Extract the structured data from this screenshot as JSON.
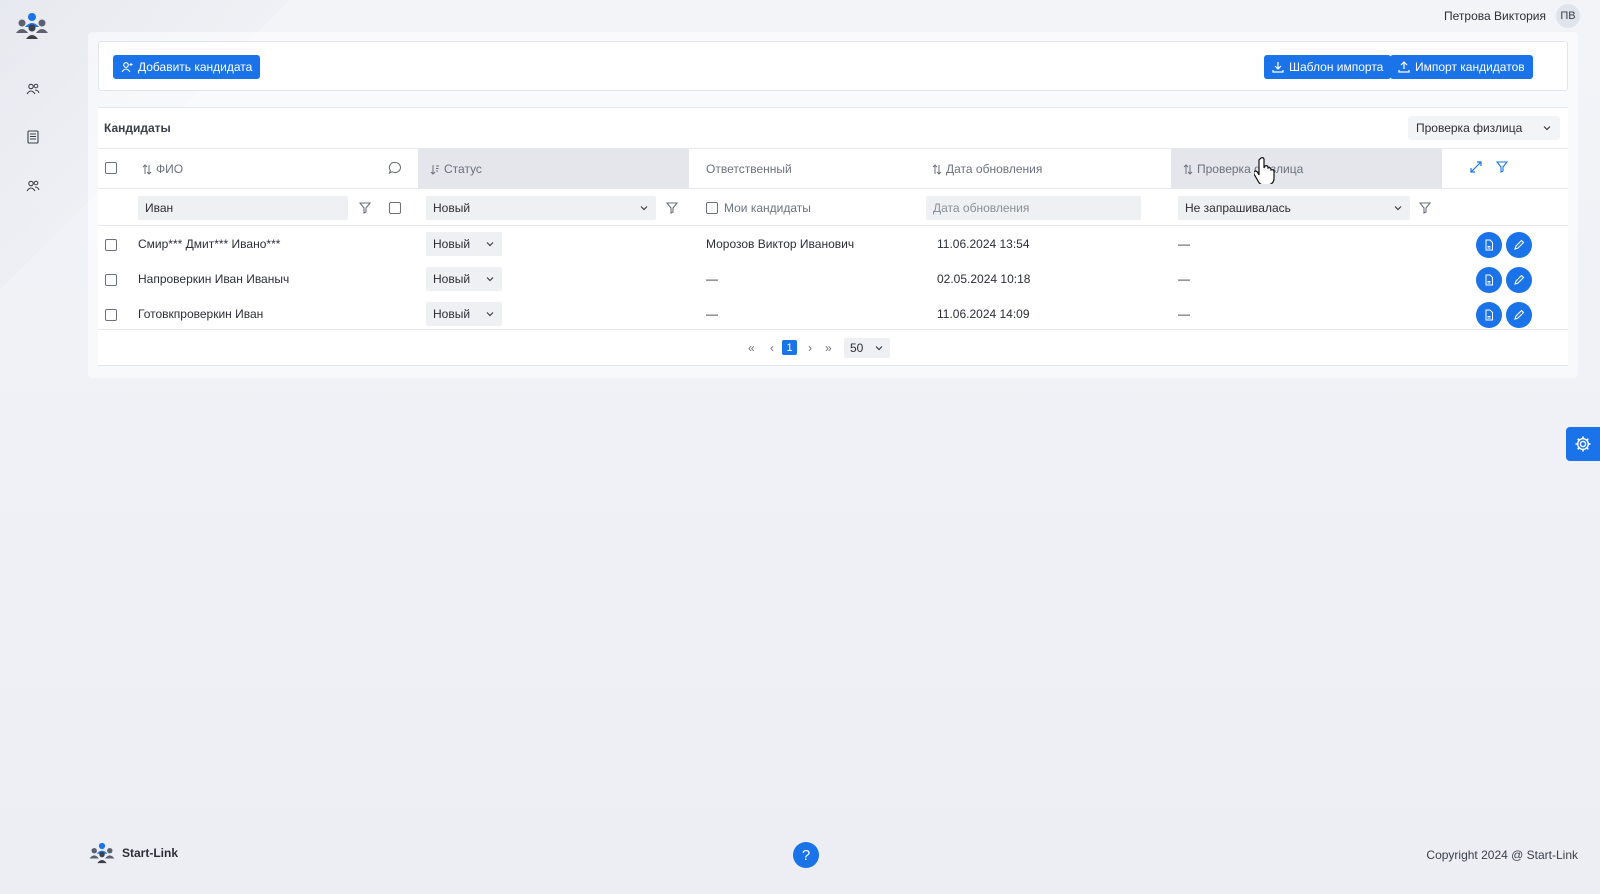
{
  "user": {
    "name": "Петрова Виктория",
    "initials": "ПВ"
  },
  "toolbar": {
    "add_candidate": "Добавить кандидата",
    "import_template": "Шаблон импорта",
    "import_candidates": "Импорт кандидатов"
  },
  "panel": {
    "title": "Кандидаты",
    "view_select": "Проверка физлица"
  },
  "columns": {
    "fio": "ФИО",
    "status": "Статус",
    "responsible": "Ответственный",
    "updated": "Дата обновления",
    "check": "Проверка физлица"
  },
  "filters": {
    "fio_value": "Иван",
    "status_value": "Новый",
    "my_candidates": "Мои кандидаты",
    "updated_placeholder": "Дата обновления",
    "check_value": "Не запрашивалась"
  },
  "rows": [
    {
      "fio": "Смир*** Дмит*** Ивано***",
      "status": "Новый",
      "responsible": "Морозов Виктор Иванович",
      "updated": "11.06.2024 13:54",
      "check": "—"
    },
    {
      "fio": "Напроверкин Иван Иваныч",
      "status": "Новый",
      "responsible": "—",
      "updated": "02.05.2024 10:18",
      "check": "—"
    },
    {
      "fio": "Готовкпроверкин Иван",
      "status": "Новый",
      "responsible": "—",
      "updated": "11.06.2024 14:09",
      "check": "—"
    }
  ],
  "pagination": {
    "first": "«",
    "prev": "‹",
    "current": "1",
    "next": "›",
    "last": "»",
    "page_size": "50"
  },
  "footer": {
    "brand": "Start-Link",
    "help": "?",
    "copyright": "Copyright 2024 @ Start-Link"
  },
  "colors": {
    "accent": "#1a73e8",
    "highlight_column": "#e4e6ec"
  },
  "icons": [
    "team-logo-icon",
    "users-icon",
    "document-icon",
    "users-icon",
    "user-add-icon",
    "download-icon",
    "upload-icon",
    "comment-icon",
    "sort-icon",
    "filter-icon",
    "expand-icon",
    "chevron-down-icon",
    "pdf-icon",
    "edit-icon",
    "gear-icon",
    "pointer-cursor-icon"
  ]
}
